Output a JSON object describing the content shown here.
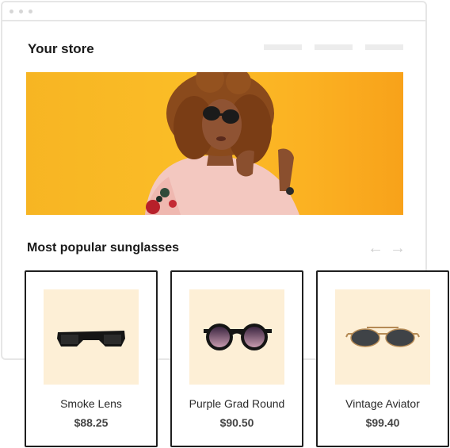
{
  "store": {
    "title": "Your store"
  },
  "hero": {
    "image": "woman-with-sunglasses-photo",
    "background_color": "#fbbd27"
  },
  "section": {
    "title": "Most popular sunglasses",
    "prev_icon": "←",
    "next_icon": "→"
  },
  "products": [
    {
      "name": "Smoke Lens",
      "price": "$88.25",
      "icon": "rectangular-sunglasses"
    },
    {
      "name": "Purple Grad Round",
      "price": "$90.50",
      "icon": "round-sunglasses"
    },
    {
      "name": "Vintage Aviator",
      "price": "$99.40",
      "icon": "aviator-sunglasses"
    }
  ],
  "colors": {
    "thumb_bg": "#fdefd6",
    "card_border": "#1f1f1f",
    "accent": "#fbbd27"
  }
}
